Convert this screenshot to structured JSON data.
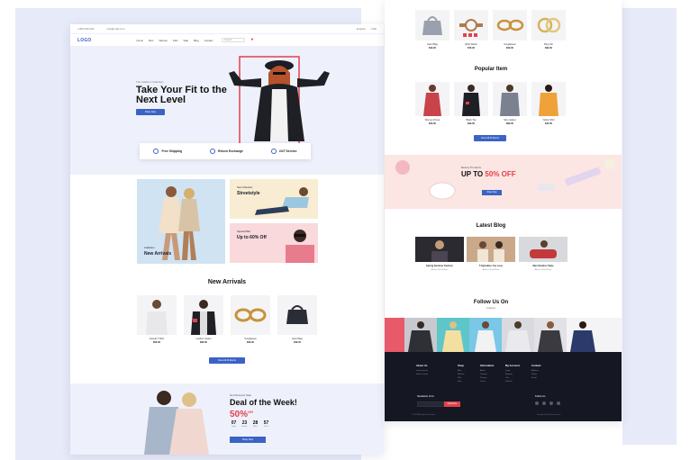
{
  "colors": {
    "accent": "#3b63c4",
    "sale": "#e2414d",
    "footer": "#151823",
    "panel": "#e7eaf8"
  },
  "left": {
    "topbar": {
      "left_1": "+000 000 000",
      "left_2": "info@mail.com",
      "right_1": "English",
      "right_2": "USD"
    },
    "nav": {
      "logo": "LOGO",
      "items": [
        "Home",
        "Men",
        "Women",
        "Kids",
        "Sale",
        "Blog",
        "Contact"
      ],
      "search_placeholder": "Search",
      "cart_icon": "cart-icon"
    },
    "hero": {
      "kicker": "The Fashion Collection",
      "title": "Take Your Fit to the Next Level",
      "button": "Shop Now"
    },
    "features": [
      {
        "label": "Free Shipping",
        "icon": "truck-icon"
      },
      {
        "label": "Return Exchange",
        "icon": "return-icon"
      },
      {
        "label": "24/7 Service",
        "icon": "support-icon"
      }
    ],
    "banners": {
      "arrivals_kicker": "Collection",
      "arrivals_title": "New Arrivals",
      "street_kicker": "New Collection",
      "street_title": "Streetstyle",
      "sale_kicker": "Special Offer",
      "sale_title": "Up to 60% Off"
    },
    "new_arrivals": {
      "title": "New Arrivals",
      "products": [
        {
          "name": "Casual T-Shirt",
          "price": "$59.00"
        },
        {
          "name": "Leather Jacket",
          "price": "$69.00"
        },
        {
          "name": "Sunglasses",
          "price": "$29.00"
        },
        {
          "name": "Hand Bag",
          "price": "$49.00"
        }
      ],
      "button": "View All Products"
    },
    "deal": {
      "kicker": "Hot Discount Sale",
      "title": "Deal of the Week!",
      "discount": "50%",
      "discount_suffix": "Off",
      "timer": [
        {
          "v": "07",
          "l": "Days"
        },
        {
          "v": "23",
          "l": "Hours"
        },
        {
          "v": "28",
          "l": "Mins"
        },
        {
          "v": "57",
          "l": "Secs"
        }
      ],
      "button": "Shop Now"
    }
  },
  "right": {
    "products_top": [
      {
        "name": "Hand Bag",
        "price": "$49.00"
      },
      {
        "name": "Wrist Watch",
        "price": "$79.00"
      },
      {
        "name": "Sunglasses",
        "price": "$29.00"
      },
      {
        "name": "Ring Set",
        "price": "$99.00"
      }
    ],
    "popular": {
      "title": "Popular Item",
      "products": [
        {
          "name": "Women Dress",
          "price": "$59.00"
        },
        {
          "name": "Black Top",
          "price": "$39.00"
        },
        {
          "name": "Men Jacket",
          "price": "$89.00"
        },
        {
          "name": "Yellow Shirt",
          "price": "$45.00"
        }
      ],
      "button": "View All Products"
    },
    "promo": {
      "kicker": "Beauty Products",
      "title_prefix": "UP TO",
      "title_value": "50% OFF",
      "button": "Shop Now"
    },
    "blog": {
      "title": "Latest Blog",
      "posts": [
        {
          "title": "Spring Summer Fashion",
          "meta": "Admin  |  Read More"
        },
        {
          "title": "5 Sprinkles You Love",
          "meta": "Admin  |  Read More"
        },
        {
          "title": "Men Outdoor Style",
          "meta": "Admin  |  Read More"
        }
      ]
    },
    "follow": {
      "title": "Follow Us On",
      "subtitle": "Instagram"
    },
    "footer": {
      "cols": [
        {
          "h": "About Us",
          "items": [
            "Lorem ipsum",
            "dolor sit amet"
          ]
        },
        {
          "h": "Shop",
          "items": [
            "Men",
            "Women",
            "Kids",
            "Sale"
          ]
        },
        {
          "h": "Information",
          "items": [
            "About",
            "Contact",
            "Privacy",
            "Terms"
          ]
        },
        {
          "h": "My Account",
          "items": [
            "Login",
            "Register",
            "Cart",
            "Wishlist"
          ]
        },
        {
          "h": "Contact",
          "items": [
            "Address",
            "Phone",
            "Email"
          ]
        }
      ],
      "newsletter_label": "Newsletter Form",
      "newsletter_btn": "Subscribe",
      "follow_label": "Follow Us",
      "copyright": "© 2020 All Rights Reserved",
      "credit": "Designed by Fashion Store"
    }
  }
}
